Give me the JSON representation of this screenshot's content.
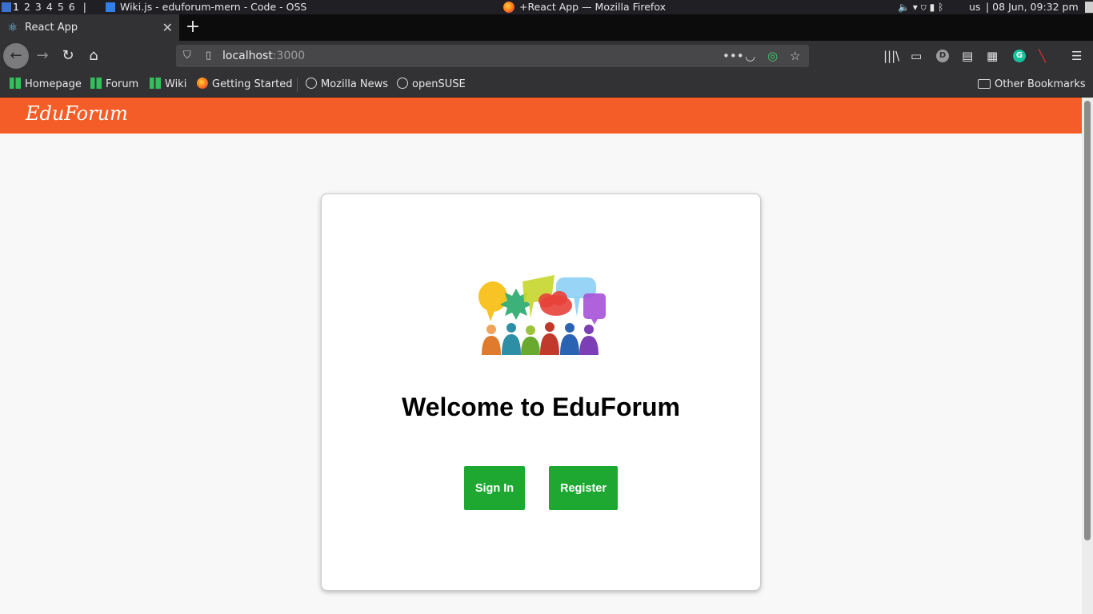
{
  "system_panel": {
    "workspaces": [
      "1",
      "2",
      "3",
      "4",
      "5",
      "6"
    ],
    "separator": "|",
    "active_window": "Wiki.js - eduforum-mern - Code - OSS",
    "window_title": "+React App — Mozilla Firefox",
    "keyboard_layout": "us",
    "datetime": "| 08 Jun, 09:32 pm"
  },
  "browser": {
    "tab": {
      "title": "React App",
      "close": "✕"
    },
    "new_tab": "+",
    "url": {
      "host": "localhost",
      "port": ":3000"
    },
    "toolbar_icons": [
      "back-icon",
      "forward-icon",
      "reload-icon",
      "home-icon",
      "library-icon",
      "sidebar-icon",
      "extension-d-icon",
      "reader-icon",
      "extensions-icon",
      "grammarly-icon",
      "disabled-extension-icon",
      "menu-icon"
    ],
    "bookmarks": [
      "Homepage",
      "Forum",
      "Wiki",
      "Getting Started",
      "Mozilla News",
      "openSUSE"
    ],
    "other_bookmarks": "Other Bookmarks"
  },
  "app": {
    "brand": "EduForum",
    "welcome_title": "Welcome to EduForum",
    "signin_label": "Sign In",
    "register_label": "Register",
    "colors": {
      "appbar": "#f45d27",
      "button": "#1ea832"
    }
  }
}
